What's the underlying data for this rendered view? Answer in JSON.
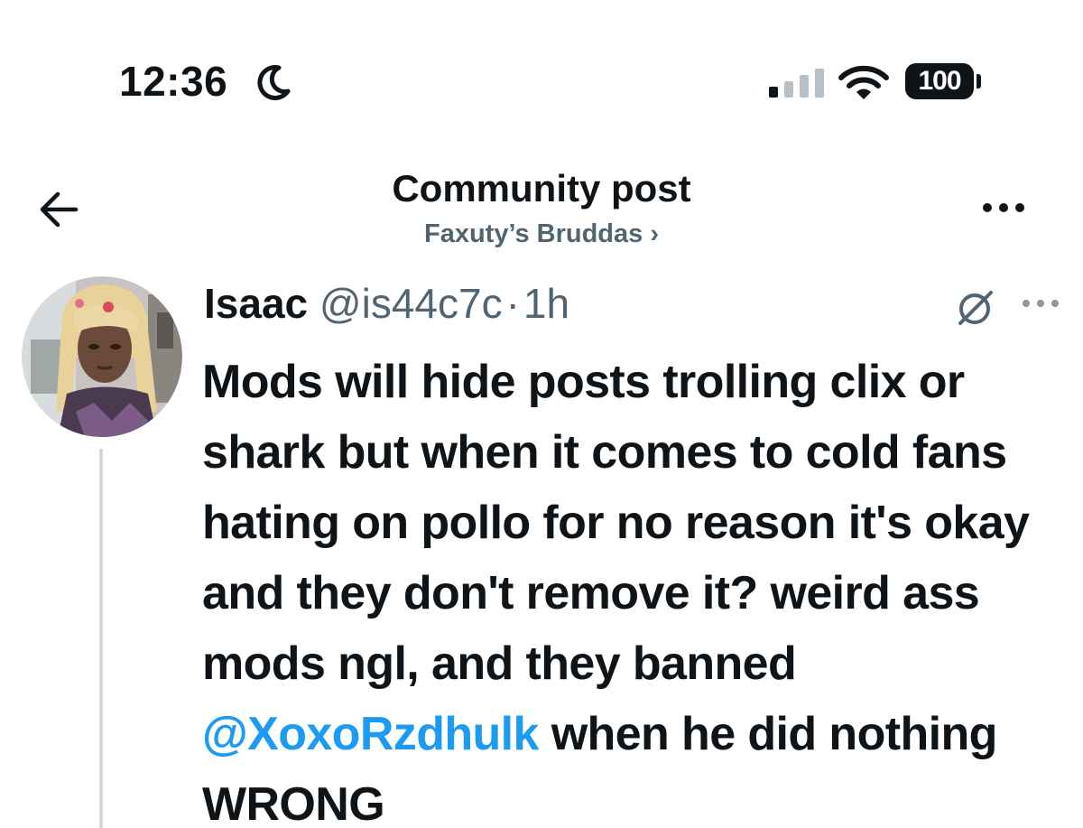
{
  "status_bar": {
    "time": "12:36",
    "battery": "100",
    "icons": [
      "moon-icon",
      "cellular-signal-icon",
      "wifi-icon",
      "battery-icon"
    ]
  },
  "header": {
    "title": "Community post",
    "community": "Faxuty’s Bruddas ›",
    "icons": [
      "back-arrow-icon",
      "more-options-icon"
    ]
  },
  "post": {
    "author_name": "Isaac",
    "handle": "@is44c7c",
    "separator": "·",
    "time": "1h",
    "text_before_mention": "Mods will hide posts trolling clix or shark but when it comes to cold fans hating on pollo for no reason it's okay and they don't remove it? weird ass mods ngl, and they banned ",
    "mention": "@XoxoRzdhulk",
    "text_after_mention": " when he did nothing WRONG",
    "icons": [
      "grok-icon",
      "more-options-icon",
      "avatar"
    ]
  },
  "colors": {
    "text_primary": "#0f1419",
    "text_secondary": "#536471",
    "link": "#1d9bf0",
    "thread_line": "#cfd9de",
    "background": "#ffffff"
  }
}
